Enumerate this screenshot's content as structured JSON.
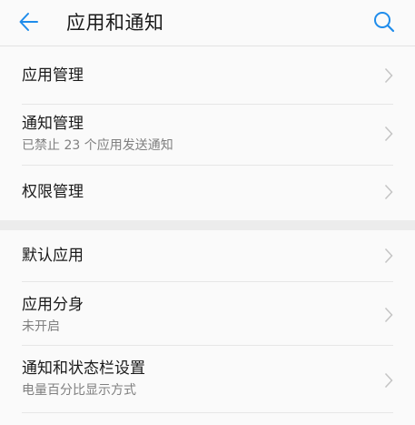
{
  "header": {
    "title": "应用和通知"
  },
  "sections": {
    "first": [
      {
        "label": "应用管理",
        "sub": ""
      },
      {
        "label": "通知管理",
        "sub": "已禁止 23 个应用发送通知"
      },
      {
        "label": "权限管理",
        "sub": ""
      }
    ],
    "second": [
      {
        "label": "默认应用",
        "sub": ""
      },
      {
        "label": "应用分身",
        "sub": "未开启"
      },
      {
        "label": "通知和状态栏设置",
        "sub": "电量百分比显示方式"
      }
    ]
  },
  "colors": {
    "accent": "#1f8ceb",
    "text_primary": "#1a1a1a",
    "text_secondary": "#808080",
    "chevron": "#c4c4c4"
  },
  "icons": {
    "back": "back-arrow-icon",
    "search": "search-icon",
    "chevron": "chevron-right-icon"
  }
}
